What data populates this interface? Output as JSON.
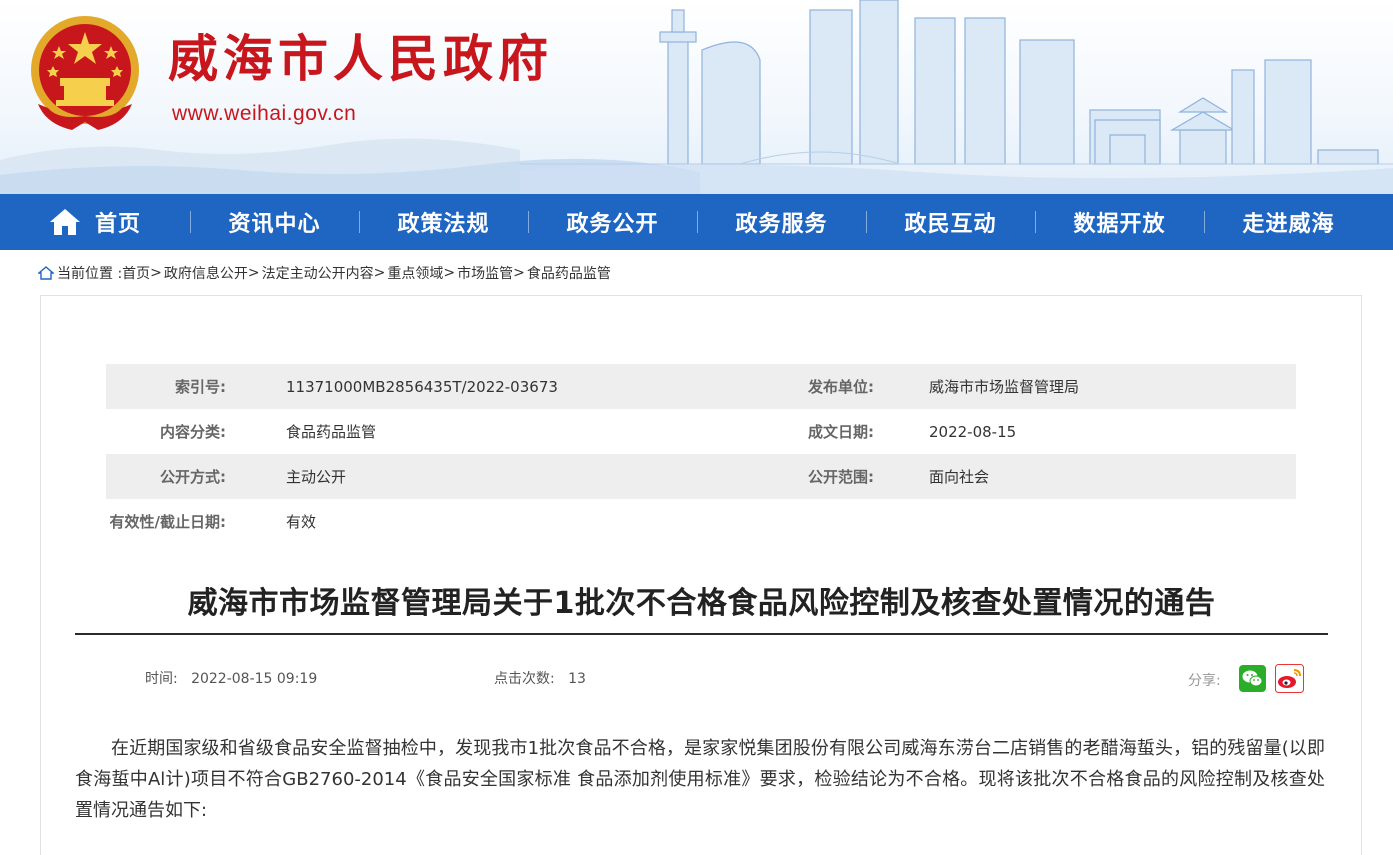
{
  "header": {
    "site_title": "威海市人民政府",
    "site_url": "www.weihai.gov.cn",
    "emblem_icon": "national-emblem-icon",
    "brand_color": "#c8161d"
  },
  "nav": {
    "color": "#1f66c3",
    "items": [
      {
        "label": "首页",
        "icon": "home-icon"
      },
      {
        "label": "资讯中心"
      },
      {
        "label": "政策法规"
      },
      {
        "label": "政务公开"
      },
      {
        "label": "政务服务"
      },
      {
        "label": "政民互动"
      },
      {
        "label": "数据开放"
      },
      {
        "label": "走进威海"
      }
    ]
  },
  "breadcrumb": {
    "prefix": "当前位置 :",
    "items": [
      "首页",
      "政府信息公开",
      "法定主动公开内容",
      "重点领域",
      "市场监管",
      "食品药品监管"
    ],
    "separator": ">"
  },
  "meta": {
    "index_no_label": "索引号:",
    "index_no": "11371000MB2856435T/2022-03673",
    "publisher_label": "发布单位:",
    "publisher": "威海市市场监督管理局",
    "category_label": "内容分类:",
    "category": "食品药品监管",
    "doc_date_label": "成文日期:",
    "doc_date": "2022-08-15",
    "disclosure_label": "公开方式:",
    "disclosure": "主动公开",
    "scope_label": "公开范围:",
    "scope": "面向社会",
    "validity_label": "有效性/截止日期:",
    "validity": "有效"
  },
  "article": {
    "title": "威海市市场监督管理局关于1批次不合格食品风险控制及核查处置情况的通告",
    "time_label": "时间:",
    "time": "2022-08-15 09:19",
    "clicks_label": "点击次数:",
    "clicks": "13",
    "share_label": "分享:",
    "share_icons": [
      "wechat-icon",
      "weibo-icon"
    ],
    "body": "在近期国家级和省级食品安全监督抽检中，发现我市1批次食品不合格，是家家悦集团股份有限公司威海东涝台二店销售的老醋海蜇头，铝的残留量(以即食海蜇中Al计)项目不符合GB2760-2014《食品安全国家标准 食品添加剂使用标准》要求，检验结论为不合格。现将该批次不合格食品的风险控制及核查处置情况通告如下:"
  }
}
